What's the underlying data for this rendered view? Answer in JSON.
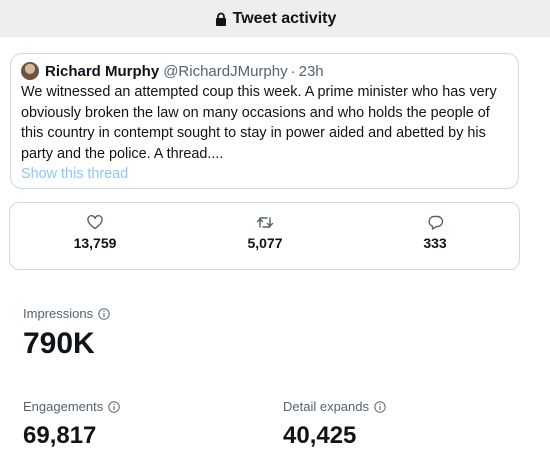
{
  "header": {
    "title": "Tweet activity",
    "icon": "lock-icon"
  },
  "tweet": {
    "author_name": "Richard Murphy",
    "handle": "@RichardJMurphy",
    "separator": "·",
    "time": "23h",
    "text": "We witnessed an attempted coup this week. A prime minister who has very obviously broken the law on many occasions and who holds the people of this country in contempt sought to stay in power aided and abetted by his party and the police. A thread....",
    "show_thread": "Show this thread"
  },
  "actions": {
    "likes": {
      "icon": "heart-icon",
      "count": "13,759"
    },
    "retweets": {
      "icon": "retweet-icon",
      "count": "5,077"
    },
    "replies": {
      "icon": "reply-icon",
      "count": "333"
    }
  },
  "stats": {
    "impressions": {
      "label": "Impressions",
      "value": "790K"
    },
    "engagements": {
      "label": "Engagements",
      "value": "69,817"
    },
    "detail_expands": {
      "label": "Detail expands",
      "value": "40,425"
    }
  },
  "colors": {
    "link": "#8ec7f3",
    "text": "#0f1419",
    "secondary": "#536471",
    "border": "#cfd9de"
  }
}
